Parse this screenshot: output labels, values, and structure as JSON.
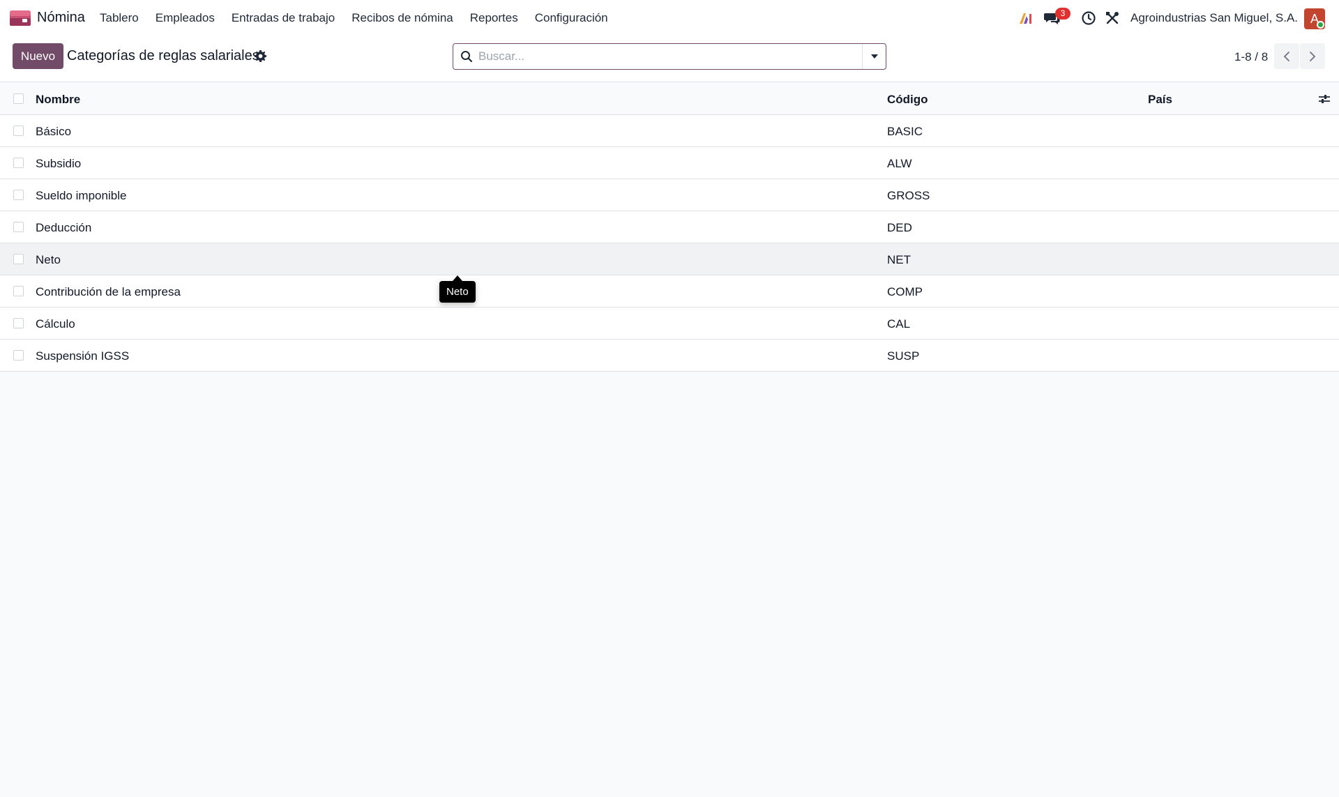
{
  "navbar": {
    "app_name": "Nómina",
    "menu": [
      {
        "label": "Tablero"
      },
      {
        "label": "Empleados"
      },
      {
        "label": "Entradas de trabajo"
      },
      {
        "label": "Recibos de nómina"
      },
      {
        "label": "Reportes"
      },
      {
        "label": "Configuración"
      }
    ],
    "messages_badge": "3",
    "company": "Agroindustrias San Miguel, S.A.",
    "avatar_initial": "A"
  },
  "control_panel": {
    "new_button": "Nuevo",
    "title": "Categorías de reglas salariales",
    "search_placeholder": "Buscar...",
    "pager": "1-8 / 8"
  },
  "table": {
    "headers": {
      "name": "Nombre",
      "code": "Código",
      "country": "País"
    },
    "rows": [
      {
        "name": "Básico",
        "code": "BASIC",
        "country": ""
      },
      {
        "name": "Subsidio",
        "code": "ALW",
        "country": ""
      },
      {
        "name": "Sueldo imponible",
        "code": "GROSS",
        "country": ""
      },
      {
        "name": "Deducción",
        "code": "DED",
        "country": ""
      },
      {
        "name": "Neto",
        "code": "NET",
        "country": ""
      },
      {
        "name": "Contribución de la empresa",
        "code": "COMP",
        "country": ""
      },
      {
        "name": "Cálculo",
        "code": "CAL",
        "country": ""
      },
      {
        "name": "Suspensión IGSS",
        "code": "SUSP",
        "country": ""
      }
    ]
  },
  "tooltip": {
    "text": "Neto"
  },
  "colors": {
    "brand": "#714b67",
    "badge": "#e03131",
    "avatar": "#c2452f",
    "online": "#28a745"
  },
  "icons": [
    "app-logo-icon",
    "ai-icon",
    "chat-icon",
    "clock-icon",
    "tools-icon",
    "gear-icon",
    "search-icon",
    "caret-down-icon",
    "chevron-left-icon",
    "chevron-right-icon",
    "column-options-icon"
  ]
}
